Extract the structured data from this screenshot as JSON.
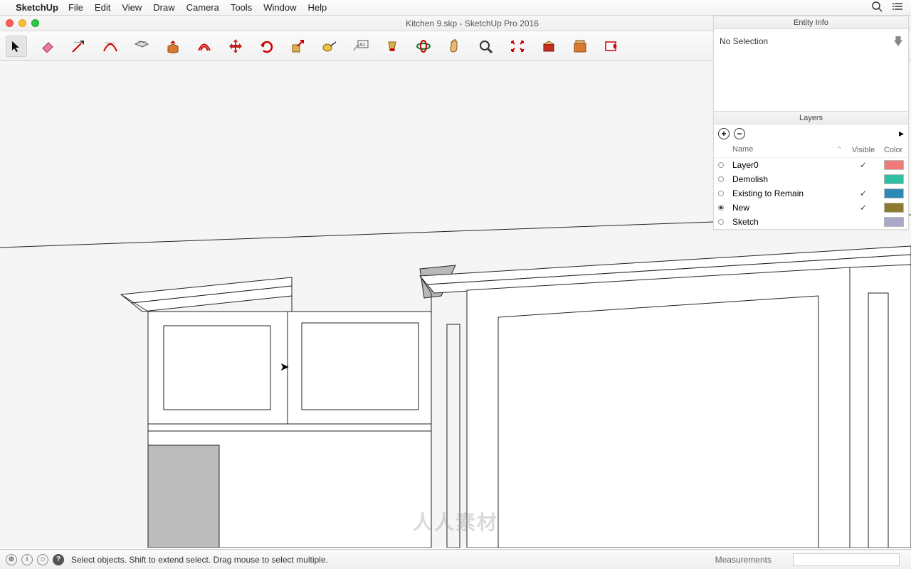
{
  "menubar": {
    "app": "SketchUp",
    "items": [
      "File",
      "Edit",
      "View",
      "Draw",
      "Camera",
      "Tools",
      "Window",
      "Help"
    ]
  },
  "window": {
    "title": "Kitchen 9.skp - SketchUp Pro 2016"
  },
  "toolbar": {
    "tools": [
      {
        "name": "select-tool",
        "active": true
      },
      {
        "name": "eraser-tool"
      },
      {
        "name": "line-tool"
      },
      {
        "name": "arc-tool"
      },
      {
        "name": "rectangle-tool"
      },
      {
        "name": "pushpull-tool"
      },
      {
        "name": "offset-tool"
      },
      {
        "name": "move-tool"
      },
      {
        "name": "rotate-tool"
      },
      {
        "name": "scale-tool"
      },
      {
        "name": "tape-tool"
      },
      {
        "name": "text-tool"
      },
      {
        "name": "paint-tool"
      },
      {
        "name": "orbit-tool"
      },
      {
        "name": "pan-tool"
      },
      {
        "name": "zoom-tool"
      },
      {
        "name": "zoom-extents-tool"
      },
      {
        "name": "get-models-tool"
      },
      {
        "name": "3dwarehouse-tool"
      },
      {
        "name": "extension-tool"
      }
    ]
  },
  "entity_info": {
    "title": "Entity Info",
    "selection": "No Selection"
  },
  "layers": {
    "title": "Layers",
    "headers": {
      "name": "Name",
      "visible": "Visible",
      "color": "Color"
    },
    "rows": [
      {
        "name": "Layer0",
        "visible": true,
        "active": false,
        "color": "#ee7b78"
      },
      {
        "name": "Demolish",
        "visible": false,
        "active": false,
        "color": "#2fc0a2"
      },
      {
        "name": "Existing to Remain",
        "visible": true,
        "active": false,
        "color": "#2d88b4"
      },
      {
        "name": "New",
        "visible": true,
        "active": true,
        "color": "#8c7a2f"
      },
      {
        "name": "Sketch",
        "visible": false,
        "active": false,
        "color": "#a9a8c9"
      }
    ]
  },
  "statusbar": {
    "hint": "Select objects. Shift to extend select. Drag mouse to select multiple.",
    "measurements_label": "Measurements"
  },
  "watermark": "人人素材"
}
